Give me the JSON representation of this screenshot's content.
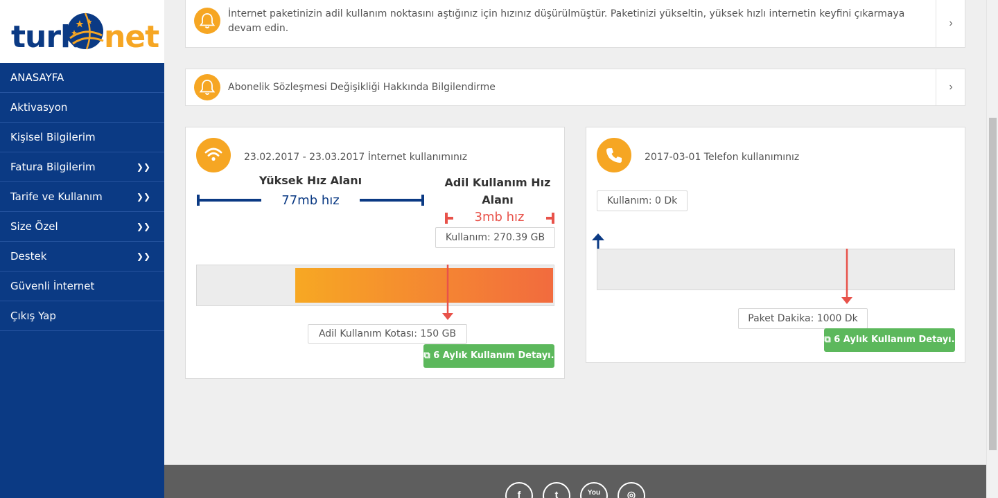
{
  "brand": {
    "logo_left": "turk",
    "logo_right": "net",
    "colors": {
      "primary": "#0b3a84",
      "accent": "#f6a623",
      "success": "#5cb85c",
      "danger": "#e8524a"
    }
  },
  "sidebar": {
    "items": [
      {
        "label": "ANASAYFA"
      },
      {
        "label": "Aktivasyon"
      },
      {
        "label": "Kişisel Bilgilerim"
      },
      {
        "label": "Fatura Bilgilerim",
        "expand_icon": "double-chevron-down-icon"
      },
      {
        "label": "Tarife ve Kullanım",
        "expand_icon": "double-chevron-down-icon"
      },
      {
        "label": "Size Özel",
        "expand_icon": "double-chevron-down-icon"
      },
      {
        "label": "Destek",
        "expand_icon": "double-chevron-down-icon"
      },
      {
        "label": "Güvenli İnternet"
      },
      {
        "label": "Çıkış Yap"
      }
    ]
  },
  "notifications": [
    {
      "icon": "bell-icon",
      "text": "İnternet paketinizin adil kullanım noktasını aştığınız için hızınız düşürülmüştür. Paketinizi yükseltin, yüksek hızlı internetin keyfini çıkarmaya devam edin."
    },
    {
      "icon": "bell-icon",
      "text": "Abonelik Sözleşmesi Değişikliği Hakkında Bilgilendirme"
    }
  ],
  "internet_panel": {
    "icon": "wifi-icon",
    "title": "23.02.2017 - 23.03.2017 İnternet kullanımınız",
    "high_speed_label": "Yüksek Hız Alanı",
    "high_speed_value": "77mb hız",
    "fair_use_label": "Adil Kullanım Hız Alanı",
    "fair_use_value": "3mb hız",
    "usage": "Kullanım: 270.39 GB",
    "quota": "Adil Kullanım Kotası: 150 GB",
    "detail_button": "6 Aylık Kullanım Detayı."
  },
  "phone_panel": {
    "icon": "phone-icon",
    "title": "2017-03-01 Telefon kullanımınız",
    "usage": "Kullanım: 0 Dk",
    "package": "Paket Dakika: 1000 Dk",
    "detail_button": "6 Aylık Kullanım Detayı."
  },
  "footer": {
    "social": [
      {
        "icon": "facebook-icon",
        "glyph": "f"
      },
      {
        "icon": "twitter-icon",
        "glyph": "t"
      },
      {
        "icon": "youtube-icon",
        "glyph": "You"
      },
      {
        "icon": "instagram-icon",
        "glyph": "◎"
      }
    ]
  }
}
